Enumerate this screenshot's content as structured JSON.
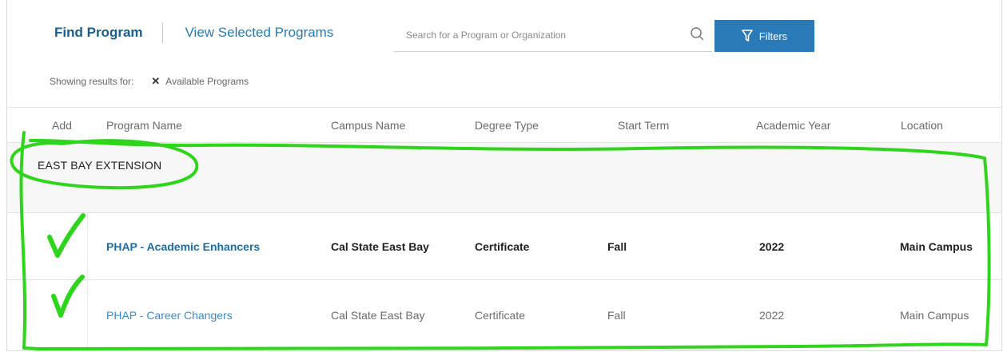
{
  "nav": {
    "find_program": "Find Program",
    "view_selected": "View Selected Programs"
  },
  "search": {
    "placeholder": "Search for a Program or Organization",
    "icon": "search-icon"
  },
  "filters": {
    "label": "Filters",
    "icon": "filter-icon"
  },
  "showing": {
    "label": "Showing results for:",
    "chip": "Available Programs",
    "chip_icon": "close-icon"
  },
  "table": {
    "headers": {
      "add": "Add",
      "program": "Program Name",
      "campus": "Campus Name",
      "degree": "Degree Type",
      "term": "Start Term",
      "year": "Academic Year",
      "location": "Location"
    },
    "group": "EAST BAY EXTENSION",
    "rows": [
      {
        "program": "PHAP - Academic Enhancers",
        "campus": "Cal State East Bay",
        "degree": "Certificate",
        "term": "Fall",
        "year": "2022",
        "location": "Main Campus"
      },
      {
        "program": "PHAP - Career Changers",
        "campus": "Cal State East Bay",
        "degree": "Certificate",
        "term": "Fall",
        "year": "2022",
        "location": "Main Campus"
      }
    ]
  },
  "annotation": {
    "color": "#2fd41c",
    "marks": [
      "checkmark-icon",
      "checkmark-icon"
    ]
  },
  "colors": {
    "accent": "#2a7ab8",
    "link": "#1f6da3"
  }
}
